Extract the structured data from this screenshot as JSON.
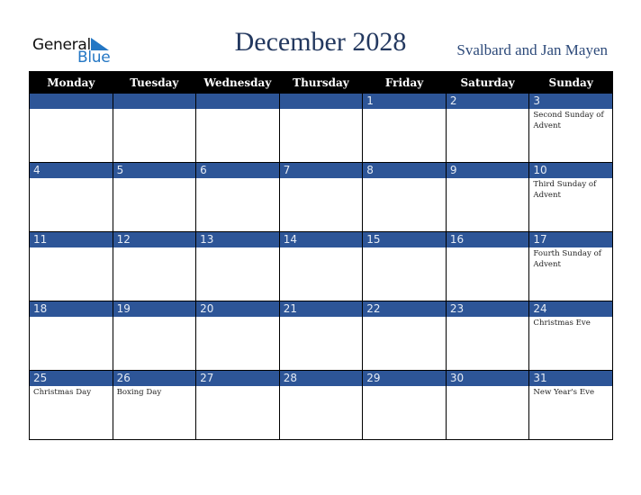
{
  "logo": {
    "general": "General",
    "blue": "Blue",
    "accent_color": "#2477c4"
  },
  "header": {
    "title": "December 2028",
    "region": "Svalbard and Jan Mayen"
  },
  "colors": {
    "header_bg": "#000000",
    "week_bar": "#2d5597",
    "title": "#23385f"
  },
  "weekdays": [
    "Monday",
    "Tuesday",
    "Wednesday",
    "Thursday",
    "Friday",
    "Saturday",
    "Sunday"
  ],
  "weeks": [
    [
      {
        "day": "",
        "event": ""
      },
      {
        "day": "",
        "event": ""
      },
      {
        "day": "",
        "event": ""
      },
      {
        "day": "",
        "event": ""
      },
      {
        "day": "1",
        "event": ""
      },
      {
        "day": "2",
        "event": ""
      },
      {
        "day": "3",
        "event": "Second Sunday of Advent"
      }
    ],
    [
      {
        "day": "4",
        "event": ""
      },
      {
        "day": "5",
        "event": ""
      },
      {
        "day": "6",
        "event": ""
      },
      {
        "day": "7",
        "event": ""
      },
      {
        "day": "8",
        "event": ""
      },
      {
        "day": "9",
        "event": ""
      },
      {
        "day": "10",
        "event": "Third Sunday of Advent"
      }
    ],
    [
      {
        "day": "11",
        "event": ""
      },
      {
        "day": "12",
        "event": ""
      },
      {
        "day": "13",
        "event": ""
      },
      {
        "day": "14",
        "event": ""
      },
      {
        "day": "15",
        "event": ""
      },
      {
        "day": "16",
        "event": ""
      },
      {
        "day": "17",
        "event": "Fourth Sunday of Advent"
      }
    ],
    [
      {
        "day": "18",
        "event": ""
      },
      {
        "day": "19",
        "event": ""
      },
      {
        "day": "20",
        "event": ""
      },
      {
        "day": "21",
        "event": ""
      },
      {
        "day": "22",
        "event": ""
      },
      {
        "day": "23",
        "event": ""
      },
      {
        "day": "24",
        "event": "Christmas Eve"
      }
    ],
    [
      {
        "day": "25",
        "event": "Christmas Day"
      },
      {
        "day": "26",
        "event": "Boxing Day"
      },
      {
        "day": "27",
        "event": ""
      },
      {
        "day": "28",
        "event": ""
      },
      {
        "day": "29",
        "event": ""
      },
      {
        "day": "30",
        "event": ""
      },
      {
        "day": "31",
        "event": "New Year's Eve"
      }
    ]
  ]
}
